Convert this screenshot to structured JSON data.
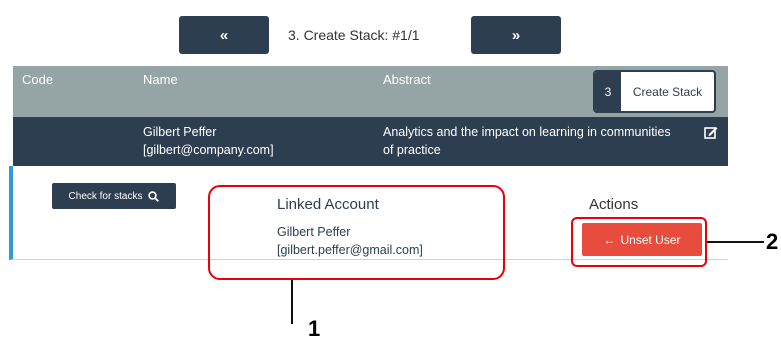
{
  "pager": {
    "prev_glyph": "«",
    "label": "3. Create Stack:  #1/1",
    "next_glyph": "»"
  },
  "table_header": {
    "code": "Code",
    "name": "Name",
    "abstract": "Abstract",
    "create_stack_count": "3",
    "create_stack_label": "Create Stack"
  },
  "row": {
    "name": "Gilbert Peffer",
    "email": "[gilbert@company.com]",
    "abstract_line1": "Analytics and the impact on learning in communities",
    "abstract_line2": "of practice"
  },
  "detail": {
    "check_label": "Check for stacks",
    "linked_title": "Linked Account",
    "linked_name": "Gilbert Peffer",
    "linked_email": "[gilbert.peffer@gmail.com]",
    "actions_title": "Actions",
    "unset_label": "Unset User"
  },
  "annotations": {
    "label1": "1",
    "label2": "2"
  },
  "colors": {
    "dark": "#2c3e50",
    "header_grey": "#95a5a6",
    "accent_blue": "#3498db",
    "danger": "#e74c3c",
    "callout_red": "#e8000b"
  }
}
